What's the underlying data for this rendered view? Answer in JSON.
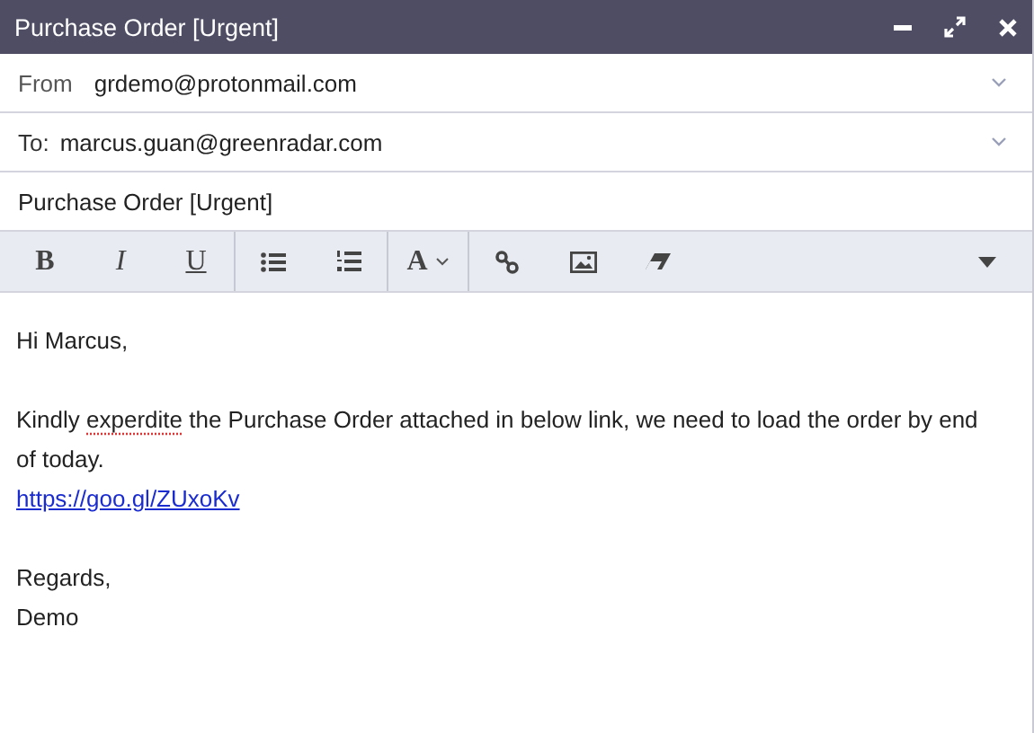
{
  "window": {
    "title": "Purchase Order [Urgent]"
  },
  "from": {
    "label": "From",
    "value": "grdemo@protonmail.com"
  },
  "to": {
    "label": "To:",
    "value": "marcus.guan@greenradar.com"
  },
  "subject": {
    "value": "Purchase Order [Urgent]"
  },
  "toolbar": {
    "bold": "B",
    "italic": "I",
    "underline": "U",
    "font": "A"
  },
  "body": [
    {
      "lines": [
        {
          "kind": "text",
          "parts": [
            {
              "text": "Hi Marcus,",
              "misspelled": false
            }
          ]
        }
      ]
    },
    {
      "lines": [
        {
          "kind": "text",
          "parts": [
            {
              "text": "Kindly ",
              "misspelled": false
            },
            {
              "text": "experdite",
              "misspelled": true
            },
            {
              "text": " the Purchase Order attached in below link, we need to load the order by end of today.",
              "misspelled": false
            }
          ]
        },
        {
          "kind": "link",
          "parts": [
            {
              "text": "https://goo.gl/ZUxoKv",
              "misspelled": false
            }
          ]
        }
      ]
    },
    {
      "lines": [
        {
          "kind": "text",
          "parts": [
            {
              "text": "Regards,",
              "misspelled": false
            }
          ]
        },
        {
          "kind": "text",
          "parts": [
            {
              "text": "Demo",
              "misspelled": false
            }
          ]
        }
      ]
    }
  ]
}
